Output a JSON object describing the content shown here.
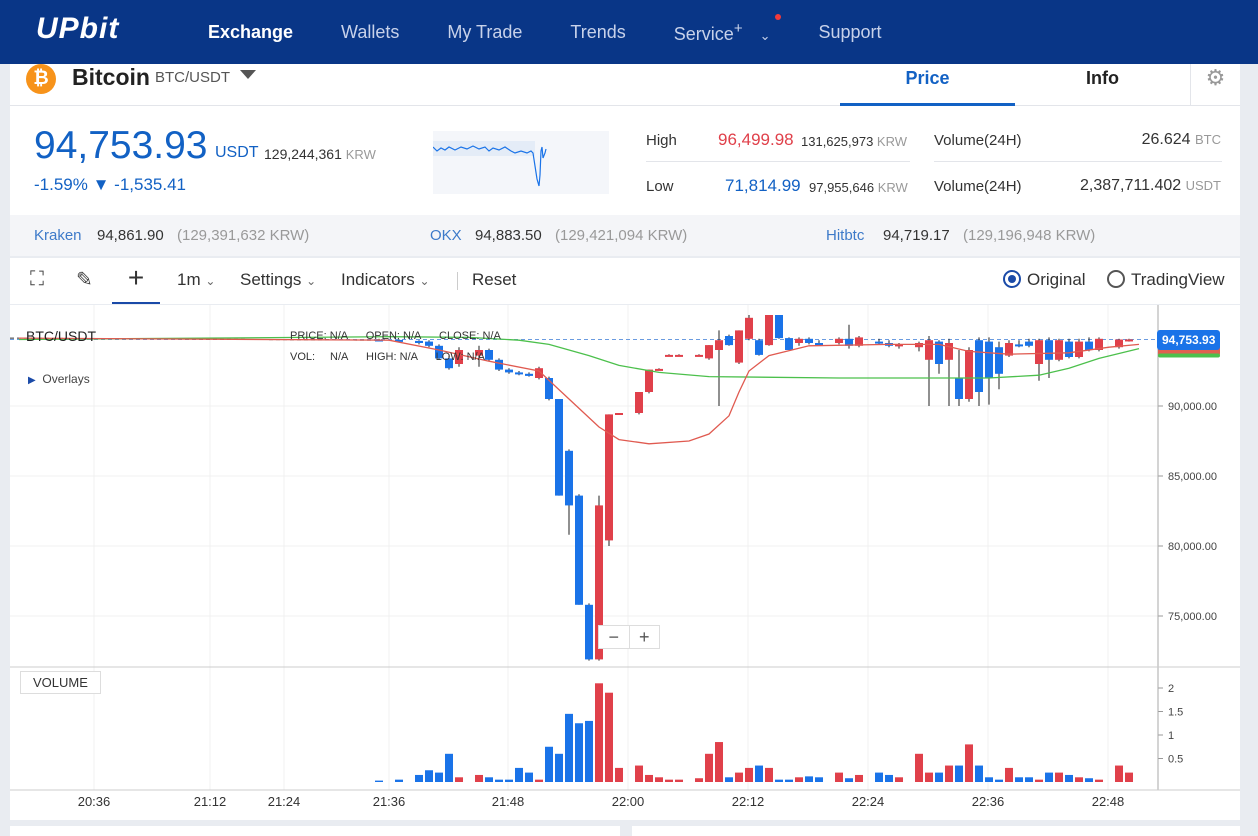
{
  "nav": {
    "logo": "UPbit",
    "items": [
      "Exchange",
      "Wallets",
      "My Trade",
      "Trends",
      "Service",
      "Support"
    ],
    "service_plus": "+"
  },
  "coin": {
    "name": "Bitcoin",
    "pair": "BTC/USDT",
    "tabs": {
      "price": "Price",
      "info": "Info"
    }
  },
  "price": {
    "value": "94,753.93",
    "unit": "USDT",
    "krw": "129,244,361",
    "krw_unit": "KRW",
    "change_pct": "-1.59%",
    "change_abs": "▼ -1,535.41"
  },
  "stats": {
    "high_label": "High",
    "high": "96,499.98",
    "high_krw": "131,625,973",
    "low_label": "Low",
    "low": "71,814.99",
    "low_krw": "97,955,646",
    "krw_unit": "KRW",
    "vol1_label": "Volume(24H)",
    "vol1": "26.624",
    "vol1_unit": "BTC",
    "vol2_label": "Volume(24H)",
    "vol2": "2,387,711.402",
    "vol2_unit": "USDT"
  },
  "exchanges": [
    {
      "name": "Kraken",
      "price": "94,861.90",
      "krw": "(129,391,632 KRW)"
    },
    {
      "name": "OKX",
      "price": "94,883.50",
      "krw": "(129,421,094 KRW)"
    },
    {
      "name": "Hitbtc",
      "price": "94,719.17",
      "krw": "(129,196,948 KRW)"
    }
  ],
  "toolbar": {
    "interval": "1m",
    "settings": "Settings",
    "indicators": "Indicators",
    "reset": "Reset",
    "original": "Original",
    "tradingview": "TradingView"
  },
  "legend": {
    "symbol": "BTC/USDT",
    "price_l": "PRICE:",
    "price": "N/A",
    "open_l": "OPEN:",
    "open": "N/A",
    "close_l": "CLOSE:",
    "close": "N/A",
    "vol_l": "VOL:",
    "vol": "N/A",
    "high_l": "HIGH:",
    "high": "N/A",
    "low_l": "LOW:",
    "low": "N/A",
    "overlays": "Overlays",
    "volume": "VOLUME",
    "last_price": "94,753.93"
  },
  "colors": {
    "up": "#e0404a",
    "down": "#1a73e8",
    "ma_short": "#e05a50",
    "ma_long": "#4cc04c",
    "brand": "#093687",
    "accent": "#1261c4"
  },
  "chart_data": {
    "type": "candlestick",
    "price_axis": {
      "ticks": [
        75000,
        80000,
        85000,
        90000
      ],
      "labels": [
        "75,000.00",
        "80,000.00",
        "85,000.00",
        "90,000.00"
      ]
    },
    "volume_axis": {
      "ticks": [
        0.5,
        1,
        1.5,
        2
      ],
      "labels": [
        "0.5",
        "1",
        "1.5",
        "2"
      ]
    },
    "time_labels": [
      "20:36",
      "21:12",
      "21:24",
      "21:36",
      "21:48",
      "22:00",
      "22:12",
      "22:24",
      "22:36",
      "22:48"
    ],
    "candles_note": "minute offset from 21:36, open, high, low, close, volume",
    "candles": [
      [
        -1,
        94750,
        94800,
        94700,
        94720,
        0.03
      ],
      [
        1,
        94720,
        94760,
        94600,
        94650,
        0.05
      ],
      [
        3,
        94650,
        94700,
        94400,
        94500,
        0.15
      ],
      [
        4,
        94600,
        94700,
        94200,
        94300,
        0.25
      ],
      [
        5,
        94300,
        94400,
        93300,
        93400,
        0.2
      ],
      [
        6,
        93400,
        93600,
        92600,
        92700,
        0.6
      ],
      [
        7,
        93000,
        94200,
        92800,
        94000,
        0.1
      ],
      [
        9,
        93600,
        94300,
        92800,
        94000,
        0.15
      ],
      [
        10,
        94000,
        94100,
        93200,
        93300,
        0.1
      ],
      [
        11,
        93300,
        93400,
        92500,
        92600,
        0.05
      ],
      [
        12,
        92600,
        92700,
        92300,
        92400,
        0.05
      ],
      [
        13,
        92400,
        92500,
        92200,
        92300,
        0.3
      ],
      [
        14,
        92300,
        92400,
        92100,
        92150,
        0.2
      ],
      [
        15,
        92000,
        92800,
        91900,
        92700,
        0.05
      ],
      [
        16,
        92000,
        92100,
        90400,
        90500,
        0.75
      ],
      [
        17,
        90500,
        90500,
        83600,
        83600,
        0.6
      ],
      [
        18,
        86800,
        86900,
        80800,
        82900,
        1.45
      ],
      [
        19,
        83600,
        83700,
        75800,
        75800,
        1.25
      ],
      [
        20,
        75800,
        75900,
        71815,
        71900,
        1.3
      ],
      [
        21,
        71900,
        83600,
        71815,
        82900,
        2.1
      ],
      [
        22,
        80400,
        89400,
        80000,
        89400,
        1.9
      ],
      [
        23,
        89450,
        89500,
        89400,
        89500,
        0.3
      ],
      [
        25,
        89500,
        91000,
        89400,
        91000,
        0.35
      ],
      [
        26,
        91000,
        92600,
        90900,
        92600,
        0.15
      ],
      [
        27,
        92650,
        92700,
        92600,
        92650,
        0.1
      ],
      [
        28,
        93650,
        93700,
        93600,
        93650,
        0.05
      ],
      [
        29,
        93650,
        93700,
        93600,
        93650,
        0.05
      ],
      [
        31,
        93650,
        93700,
        93600,
        93650,
        0.08
      ],
      [
        32,
        93400,
        94350,
        93300,
        94350,
        0.6
      ],
      [
        33,
        94000,
        95400,
        90000,
        94700,
        0.85
      ],
      [
        34,
        95000,
        95100,
        94300,
        94350,
        0.1
      ],
      [
        35,
        93100,
        95400,
        93000,
        95400,
        0.2
      ],
      [
        36,
        94800,
        96500,
        94700,
        96300,
        0.3
      ],
      [
        37,
        94700,
        94800,
        93600,
        93650,
        0.35
      ],
      [
        38,
        94350,
        96500,
        94300,
        96500,
        0.3
      ],
      [
        39,
        96500,
        96500,
        94800,
        94850,
        0.05
      ],
      [
        40,
        94850,
        94900,
        94000,
        94000,
        0.05
      ],
      [
        41,
        94500,
        94900,
        94300,
        94800,
        0.1
      ],
      [
        42,
        94800,
        94900,
        94400,
        94500,
        0.12
      ],
      [
        43,
        94500,
        94700,
        94300,
        94400,
        0.1
      ],
      [
        45,
        94500,
        94900,
        94400,
        94800,
        0.2
      ],
      [
        46,
        94800,
        95800,
        94100,
        94300,
        0.08
      ],
      [
        47,
        94300,
        95000,
        94200,
        94900,
        0.15
      ],
      [
        49,
        94600,
        94800,
        94400,
        94500,
        0.2
      ],
      [
        50,
        94500,
        94700,
        94200,
        94300,
        0.15
      ],
      [
        51,
        94300,
        94500,
        94100,
        94400,
        0.1
      ],
      [
        53,
        94200,
        94600,
        93900,
        94500,
        0.6
      ],
      [
        54,
        93300,
        95000,
        90000,
        94700,
        0.2
      ],
      [
        55,
        94600,
        94700,
        92300,
        93000,
        0.2
      ],
      [
        56,
        93300,
        94800,
        90000,
        94500,
        0.35
      ],
      [
        57,
        92000,
        94000,
        90000,
        90500,
        0.35
      ],
      [
        58,
        90500,
        94200,
        90300,
        94000,
        0.8
      ],
      [
        59,
        94700,
        94900,
        90000,
        91000,
        0.35
      ],
      [
        60,
        94600,
        94900,
        90100,
        92000,
        0.1
      ],
      [
        61,
        94200,
        94600,
        91200,
        92300,
        0.05
      ],
      [
        62,
        93600,
        94700,
        93500,
        94500,
        0.3
      ],
      [
        63,
        94400,
        94700,
        94200,
        94300,
        0.1
      ],
      [
        64,
        94600,
        94800,
        94200,
        94300,
        0.1
      ],
      [
        65,
        93000,
        94800,
        91800,
        94700,
        0.05
      ],
      [
        66,
        94700,
        94900,
        92000,
        93300,
        0.2
      ],
      [
        67,
        93300,
        94800,
        93200,
        94700,
        0.2
      ],
      [
        68,
        94600,
        94800,
        93400,
        93500,
        0.15
      ],
      [
        69,
        93500,
        94800,
        93400,
        94600,
        0.1
      ],
      [
        70,
        94600,
        94900,
        93900,
        94000,
        0.08
      ],
      [
        71,
        94000,
        94900,
        93900,
        94800,
        0.05
      ],
      [
        73,
        94200,
        94800,
        94100,
        94750,
        0.35
      ],
      [
        74,
        94750,
        94800,
        94600,
        94754,
        0.2
      ]
    ],
    "ma_short": [
      [
        -37,
        94850
      ],
      [
        0,
        94700
      ],
      [
        5,
        94000
      ],
      [
        10,
        93200
      ],
      [
        15,
        92500
      ],
      [
        18,
        90500
      ],
      [
        21,
        88500
      ],
      [
        23,
        87600
      ],
      [
        26,
        87300
      ],
      [
        30,
        87500
      ],
      [
        32,
        88000
      ],
      [
        34,
        89300
      ],
      [
        35,
        91000
      ],
      [
        36,
        92500
      ],
      [
        38,
        93600
      ],
      [
        42,
        94300
      ],
      [
        50,
        94400
      ],
      [
        55,
        94400
      ],
      [
        58,
        93900
      ],
      [
        62,
        93700
      ],
      [
        68,
        93800
      ],
      [
        72,
        94200
      ],
      [
        75,
        94400
      ]
    ],
    "ma_long": [
      [
        -37,
        94750
      ],
      [
        0,
        94950
      ],
      [
        8,
        94900
      ],
      [
        13,
        94700
      ],
      [
        16,
        94400
      ],
      [
        20,
        93600
      ],
      [
        23,
        92900
      ],
      [
        27,
        92400
      ],
      [
        32,
        92100
      ],
      [
        45,
        92000
      ],
      [
        60,
        92000
      ],
      [
        65,
        92200
      ],
      [
        68,
        92700
      ],
      [
        71,
        93400
      ],
      [
        75,
        94100
      ]
    ]
  }
}
